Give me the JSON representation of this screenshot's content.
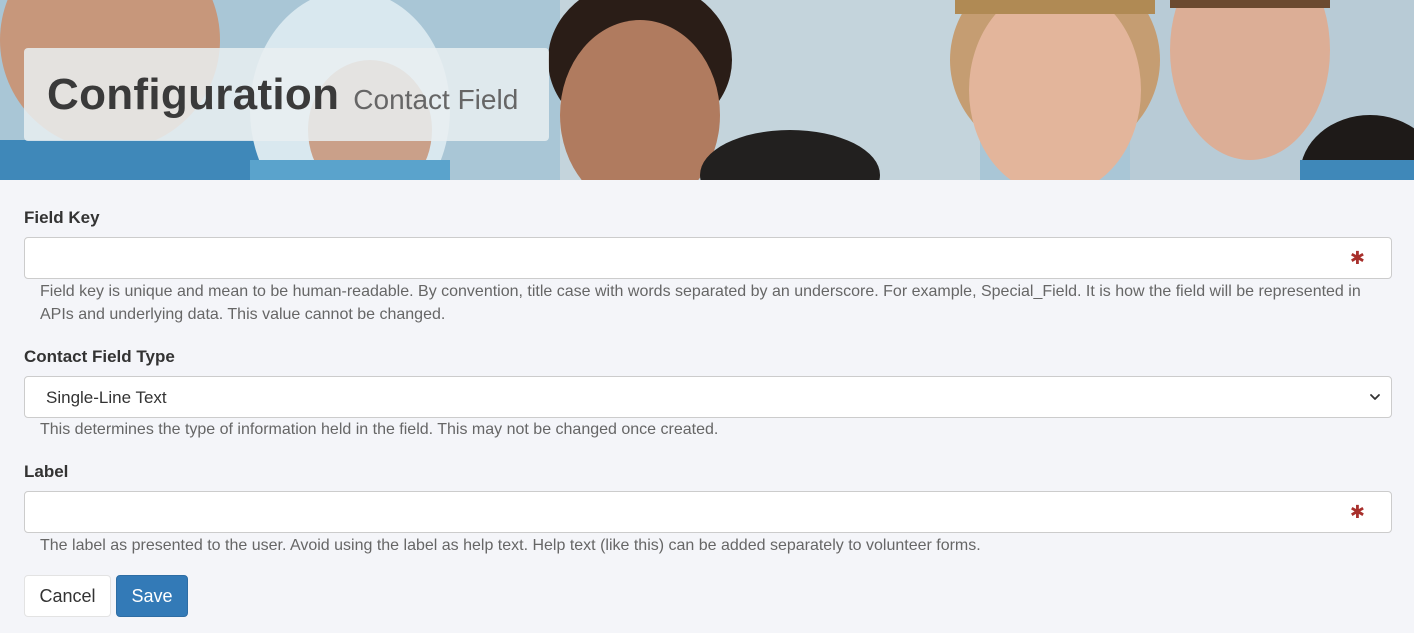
{
  "header": {
    "title": "Configuration",
    "subtitle": "Contact Field"
  },
  "form": {
    "field_key": {
      "label": "Field Key",
      "value": "",
      "required_marker": "✱",
      "help": "Field key is unique and mean to be human-readable. By convention, title case with words separated by an underscore. For example, Special_Field. It is how the field will be represented in APIs and underlying data. This value cannot be changed."
    },
    "field_type": {
      "label": "Contact Field Type",
      "selected": "Single-Line Text",
      "help": "This determines the type of information held in the field. This may not be changed once created."
    },
    "label_field": {
      "label": "Label",
      "value": "",
      "required_marker": "✱",
      "help": "The label as presented to the user. Avoid using the label as help text. Help text (like this) can be added separately to volunteer forms."
    },
    "buttons": {
      "cancel": "Cancel",
      "save": "Save"
    }
  },
  "colors": {
    "primary": "#337ab7",
    "required": "#a8302c",
    "page_background": "#f4f5f9"
  }
}
